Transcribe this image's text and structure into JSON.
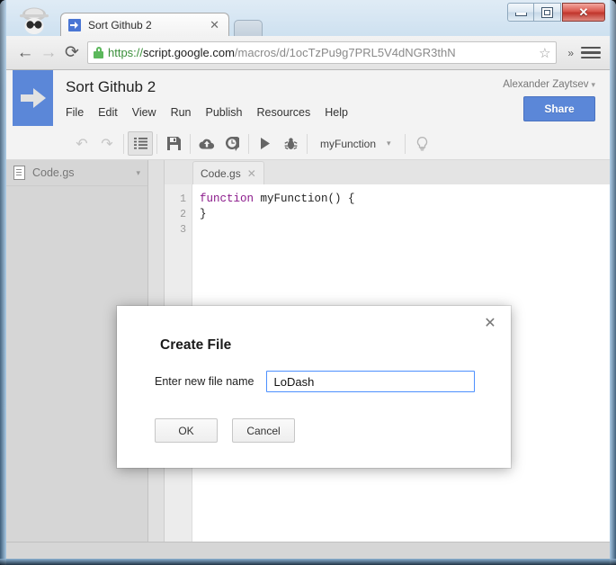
{
  "window": {
    "minimize_label": "Minimize",
    "maximize_label": "Maximize",
    "close_label": "✕"
  },
  "browser": {
    "incognito_icon": "incognito-spy-icon",
    "tab": {
      "title": "Sort Github 2",
      "close_label": "✕",
      "favicon": "apps-script-arrow-icon"
    },
    "newtab_label": "",
    "nav": {
      "back": "←",
      "forward": "→",
      "reload": "⟳"
    },
    "omnibox": {
      "scheme": "https://",
      "host": "script.google.com",
      "path": "/macros/d/1ocTzPu9g7PRL5V4dNGR3thN",
      "lock_icon": "lock-icon",
      "star_icon": "☆"
    },
    "overflow_label": "»",
    "menu_icon": "hamburger-menu-icon"
  },
  "app": {
    "logo_icon": "apps-script-logo-arrow",
    "title": "Sort Github 2",
    "menus": [
      "File",
      "Edit",
      "View",
      "Run",
      "Publish",
      "Resources",
      "Help"
    ],
    "user": "Alexander Zaytsev",
    "user_caret": "▾",
    "share_label": "Share"
  },
  "toolbar": {
    "undo": "↶",
    "redo": "↷",
    "indent": "☰",
    "save": "💾",
    "cloud": "☁",
    "history": "◷",
    "run": "▶",
    "debug": "🐛",
    "function_name": "myFunction",
    "function_caret": "▾",
    "hint": "💡"
  },
  "sidebar": {
    "file": "Code.gs",
    "caret": "▾",
    "file_icon": "file-document-icon"
  },
  "editor": {
    "tab_label": "Code.gs",
    "tab_close": "✕",
    "line_numbers": [
      "1",
      "2",
      "3"
    ],
    "code_lines": [
      {
        "keyword": "function",
        "rest": " myFunction() {"
      },
      {
        "keyword": "",
        "rest": ""
      },
      {
        "keyword": "",
        "rest": "}"
      }
    ]
  },
  "dialog": {
    "title": "Create File",
    "close_label": "✕",
    "field_label": "Enter new file name",
    "field_value": "LoDash",
    "field_placeholder": "",
    "ok_label": "OK",
    "cancel_label": "Cancel"
  },
  "colors": {
    "accent_blue": "#5b87d8",
    "focus_blue": "#4d90fe",
    "keyword_purple": "#8b1a8b",
    "lock_green": "#5cb85c",
    "close_red": "#c0352c"
  }
}
